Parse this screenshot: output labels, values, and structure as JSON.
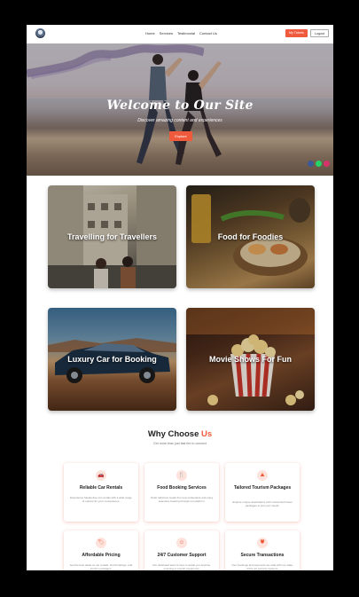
{
  "nav": {
    "links": [
      "Home",
      "Services",
      "Testimonial",
      "Contact Us"
    ],
    "tickets_label": "My Tickets",
    "logout_label": "Logout"
  },
  "hero": {
    "title": "Welcome to Our Site",
    "subtitle": "Discover amazing content and experiences",
    "cta_label": "Explore"
  },
  "cards": [
    {
      "label": "Travelling for Travellers"
    },
    {
      "label": "Food for Foodies"
    },
    {
      "label": "Luxury Car for Booking"
    },
    {
      "label": "Movie Shows For Fun"
    }
  ],
  "why": {
    "title_prefix": "Why Choose ",
    "title_accent": "Us",
    "subtitle": "Get more than just fast fee to connect",
    "features": [
      {
        "icon": "car-icon",
        "title": "Reliable Car Rentals",
        "desc": "Experience hassle-free car rentals with a wide range of options for your convenience."
      },
      {
        "icon": "utensils-icon",
        "title": "Food Booking Services",
        "desc": "Order delicious meals from top restaurants and enjoy seamless booking through our platform."
      },
      {
        "icon": "map-icon",
        "title": "Tailored Tourism Packages",
        "desc": "Explore unique destinations with customized travel packages to suit your needs."
      },
      {
        "icon": "tag-icon",
        "title": "Affordable Pricing",
        "desc": "Get the best deals on car rentals, food bookings, and tourism packages."
      },
      {
        "icon": "headset-icon",
        "title": "24/7 Customer Support",
        "desc": "Our dedicated team is here to assist you anytime, ensuring a smooth experience."
      },
      {
        "icon": "shield-icon",
        "title": "Secure Transactions",
        "desc": "Your bookings and payments are safe with our state-of-the-art security systems."
      }
    ]
  },
  "colors": {
    "accent": "#ef5a3c"
  }
}
